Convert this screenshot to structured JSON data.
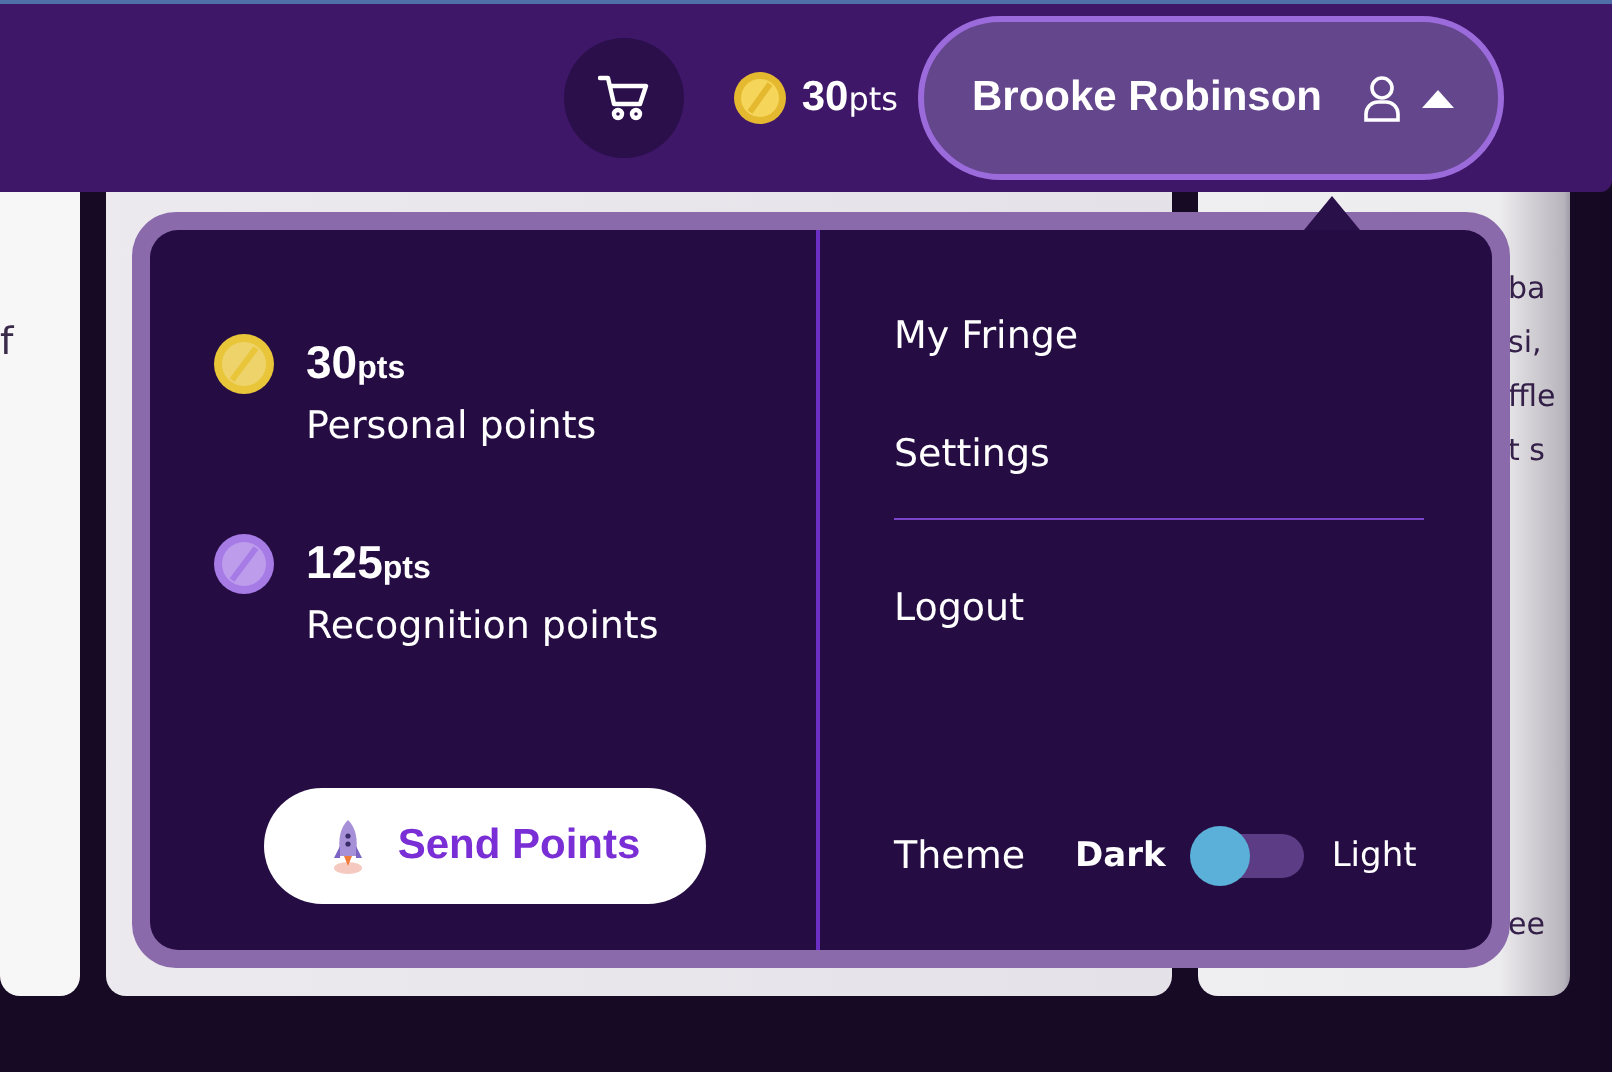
{
  "header": {
    "points": {
      "value": "30",
      "unit": "pts"
    },
    "user": {
      "name": "Brooke Robinson",
      "expanded": true
    }
  },
  "background_cards": [
    {
      "kind": "card",
      "lines": [
        "f"
      ]
    },
    {
      "kind": "card"
    },
    {
      "kind": "card",
      "lines": [
        "ba",
        "si,",
        "ffle",
        "t s"
      ],
      "bottom_lines": [
        "ee"
      ]
    }
  ],
  "account_menu": {
    "points": [
      {
        "value": "30",
        "unit": "pts",
        "label": "Personal points",
        "color": "#e9c53a"
      },
      {
        "value": "125",
        "unit": "pts",
        "label": "Recognition points",
        "color": "#a77be6"
      }
    ],
    "send_button": "Send Points",
    "links": [
      {
        "label": "My Fringe",
        "kind": "link"
      },
      {
        "label": "Settings",
        "kind": "link"
      },
      {
        "kind": "divider"
      },
      {
        "label": "Logout",
        "kind": "link"
      }
    ],
    "theme": {
      "label": "Theme",
      "options": [
        {
          "label": "Dark",
          "selected": true
        },
        {
          "label": "Light",
          "selected": false
        }
      ]
    }
  }
}
